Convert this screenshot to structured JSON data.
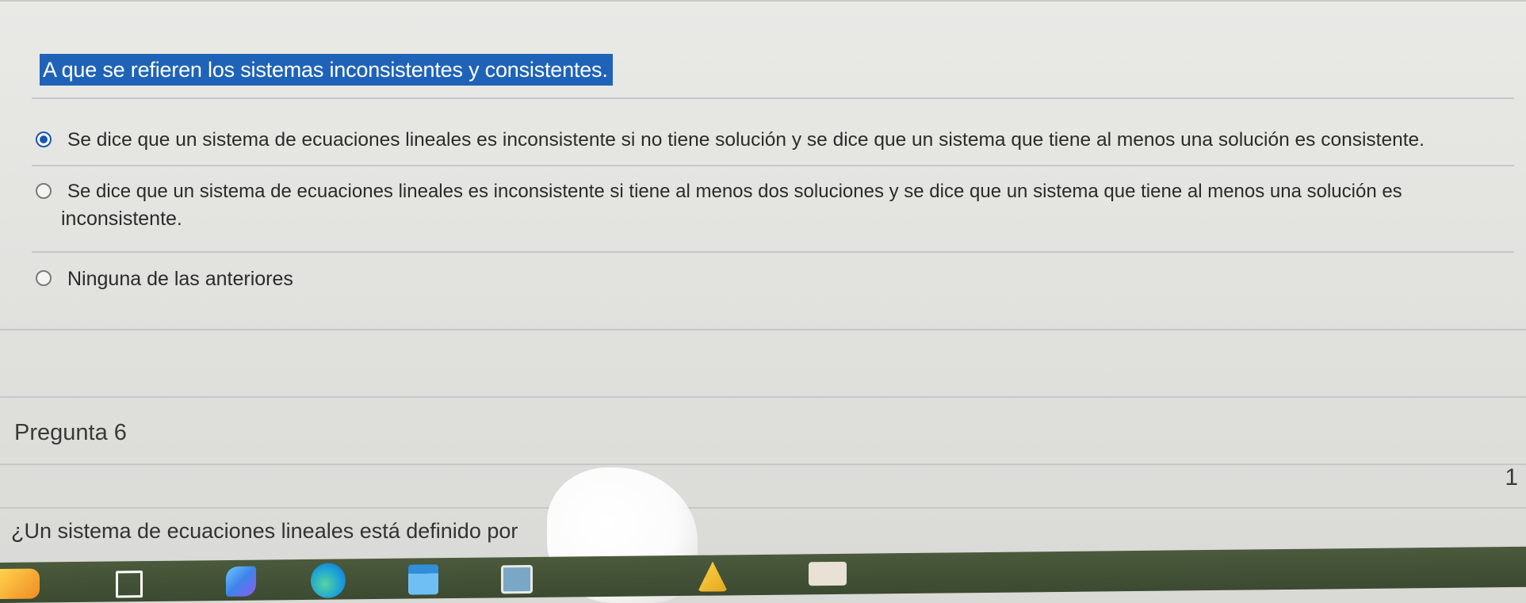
{
  "question": {
    "text": "A que se refieren los sistemas inconsistentes y consistentes."
  },
  "answers": [
    {
      "label": "Se dice que un sistema de ecuaciones lineales es inconsistente si no tiene solución y se dice que un sistema que tiene al menos una solución es consistente.",
      "selected": true
    },
    {
      "label": "Se dice que un sistema de ecuaciones lineales es inconsistente si tiene al menos dos soluciones y se dice que un sistema que tiene al menos una solución es",
      "label_cont": "inconsistente.",
      "selected": false
    },
    {
      "label": "Ninguna de las anteriores",
      "selected": false
    }
  ],
  "next_question": {
    "title": "Pregunta 6",
    "points": "1",
    "prompt": "¿Un sistema de ecuaciones lineales está definido por"
  },
  "taskbar": {
    "icons": [
      "start-icon",
      "task-view-icon",
      "app-icon",
      "edge-browser-icon",
      "store-icon",
      "photos-icon",
      "app-icon",
      "app-icon"
    ]
  },
  "colors": {
    "selection_highlight": "#1f63b8",
    "radio_selected": "#1a56b0",
    "taskbar": "#4b5a3c"
  }
}
